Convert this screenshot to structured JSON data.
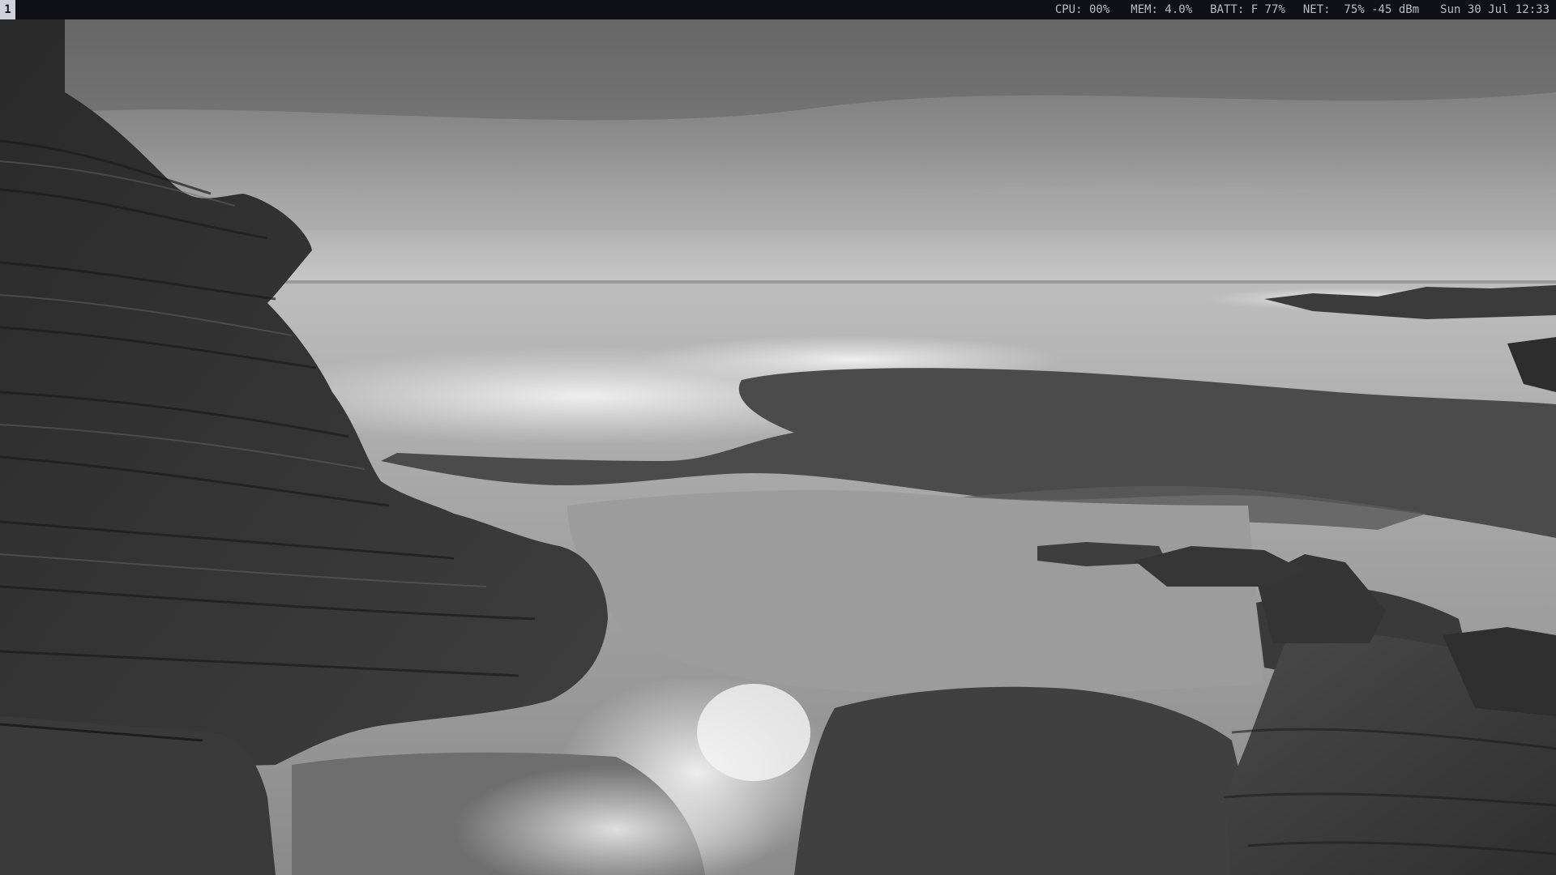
{
  "workspace": {
    "active_label": "1"
  },
  "status": {
    "cpu": "CPU: 00%",
    "mem": "MEM: 4.0%",
    "batt": "BATT: F 77%",
    "net": "NET:  75% -45 dBm",
    "clock": "Sun 30 Jul 12:33"
  },
  "wallpaper": {
    "description_icon": "seascape-wallpaper"
  },
  "colors": {
    "bar_bg": "#0f1117",
    "bar_text": "#b9bcc5",
    "workspace_active_bg": "#cfd2da"
  }
}
